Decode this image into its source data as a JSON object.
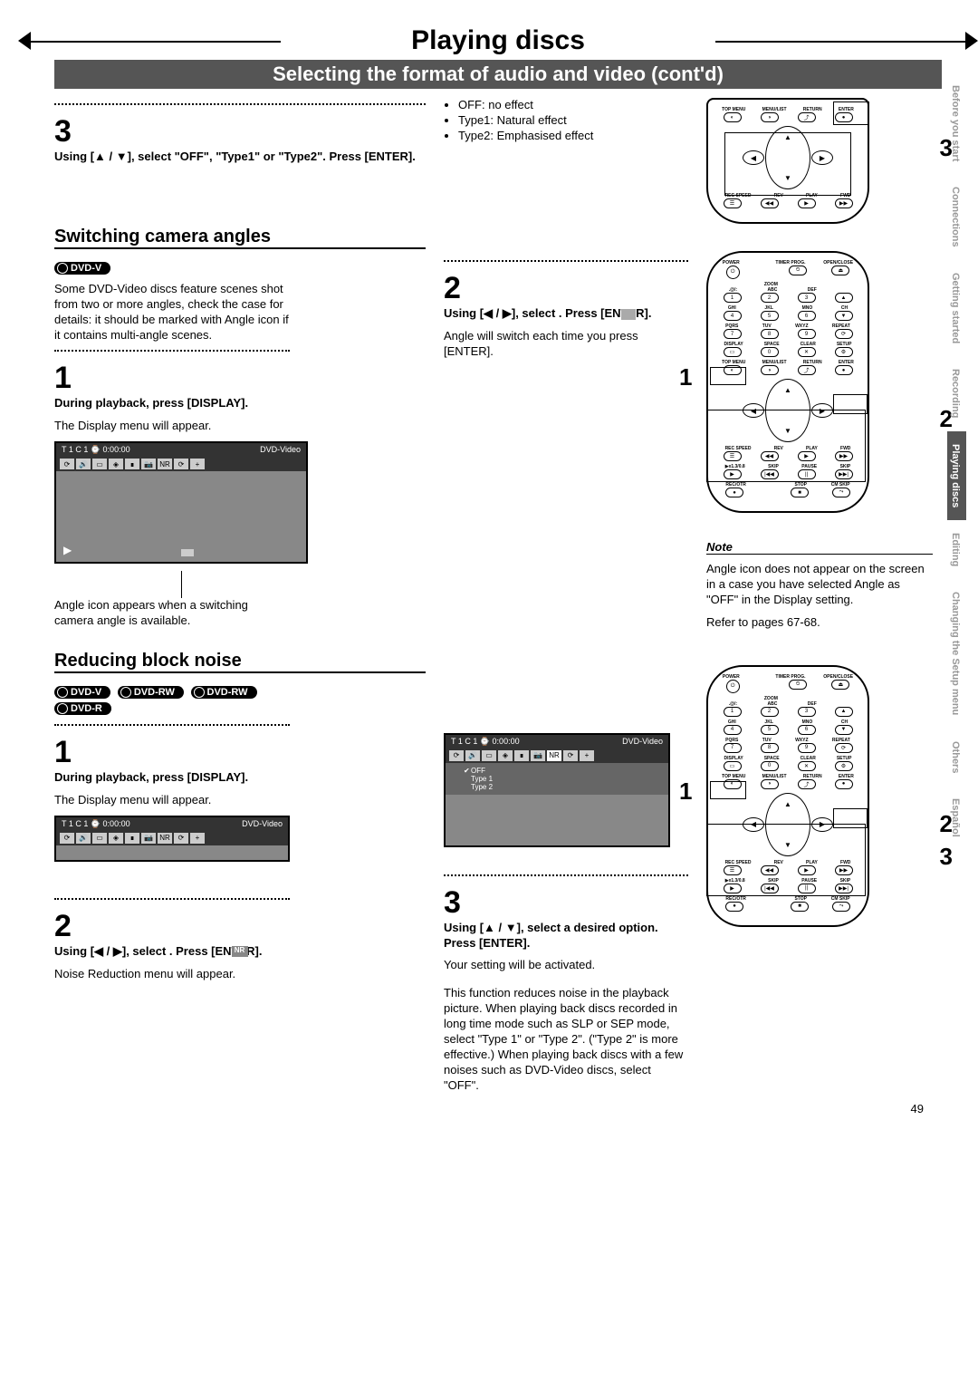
{
  "header": {
    "title": "Playing discs",
    "subtitle": "Selecting the format of audio and video (cont'd)"
  },
  "step3top": {
    "num": "3",
    "instr": "Using [▲ / ▼], select \"OFF\", \"Type1\" or \"Type2\". Press [ENTER].",
    "opts": [
      "OFF:   no effect",
      "Type1: Natural effect",
      "Type2: Emphasised effect"
    ]
  },
  "camera": {
    "heading": "Switching camera angles",
    "badge": "DVD-V",
    "intro": "Some DVD-Video discs feature scenes shot from two or more angles, check the case for details: it should be marked with Angle icon if it contains multi-angle scenes.",
    "step1_num": "1",
    "step1_instr": "During playback, press [DISPLAY].",
    "step1_text": "The Display menu will appear.",
    "step1_caption": "Angle icon appears when a switching camera angle is available.",
    "step2_num": "2",
    "step2_instr": "Using  [◀ / ▶],  select       . Press [ENTER].",
    "step2_text": "Angle will switch each time you press [ENTER]."
  },
  "note": {
    "label": "Note",
    "text": "Angle icon does not appear on the screen in a case you have selected Angle as \"OFF\" in the Display setting.",
    "ref": "Refer to pages 67-68."
  },
  "noise": {
    "heading": "Reducing block noise",
    "badges": [
      "DVD-V",
      "DVD-RW",
      "DVD-RW",
      "DVD-R"
    ],
    "step1_num": "1",
    "step1_instr": "During playback, press [DISPLAY].",
    "step1_text": "The Display menu will appear.",
    "step2_num": "2",
    "step2_instr": "Using  [◀ / ▶],  select       . Press [ENTER].",
    "step2_text": "Noise Reduction menu will appear.",
    "step3_num": "3",
    "step3_instr": "Using [▲ / ▼], select a desired option. Press [ENTER].",
    "step3_text": "Your setting will be activated.",
    "para": "This function reduces noise in the playback picture. When playing back discs recorded in long time mode such as SLP or SEP mode, select \"Type 1\" or \"Type 2\". (\"Type 2\" is more effective.) When playing back discs with a few noises such as DVD-Video discs, select \"OFF\"."
  },
  "display": {
    "topbar": "T  1  C  1   ⌚ 0:00:00",
    "label": "DVD-Video",
    "nr_menu": [
      "OFF",
      "Type 1",
      "Type 2"
    ],
    "nr_icon": "NR"
  },
  "remote": {
    "r1": [
      "TOP MENU",
      "MENU/LIST",
      "RETURN",
      "ENTER"
    ],
    "r2": [
      "REC SPEED",
      "REV",
      "PLAY",
      "FWD"
    ],
    "r3": [
      "POWER",
      "",
      "TIMER PROG.",
      "OPEN/CLOSE"
    ],
    "zoom": "ZOOM",
    "keypad_r1": [
      ".@/:",
      "ABC",
      "DEF",
      ""
    ],
    "keypad_r2": [
      "GHI",
      "JKL",
      "MNO",
      "CH"
    ],
    "keypad_r3": [
      "PQRS",
      "TUV",
      "WXYZ",
      "REPEAT"
    ],
    "keypad_r4": [
      "DISPLAY",
      "SPACE",
      "CLEAR",
      "SETUP"
    ],
    "nums_r1": [
      "1",
      "2",
      "3"
    ],
    "nums_r2": [
      "4",
      "5",
      "6"
    ],
    "nums_r3": [
      "7",
      "8",
      "9"
    ],
    "nums_r4": [
      "0"
    ],
    "r_play": [
      "▶x1.3/0.8",
      "SKIP",
      "PAUSE",
      "SKIP"
    ],
    "r_rec": [
      "REC/OTR",
      "",
      "STOP",
      "CM SKIP"
    ]
  },
  "side_tabs": [
    "Before you start",
    "Connections",
    "Getting started",
    "Recording",
    "Playing discs",
    "Editing",
    "Changing the Setup menu",
    "Others",
    "Español"
  ],
  "active_tab": 4,
  "page_num": "49",
  "callouts": {
    "c1": "1",
    "c2": "2",
    "c3": "3"
  }
}
